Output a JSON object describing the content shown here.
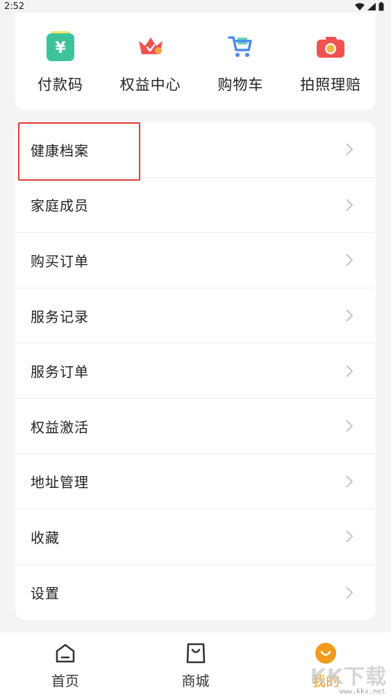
{
  "status": {
    "time": "2:52"
  },
  "quick_actions": [
    {
      "label": "付款码",
      "icon": "payment-code-icon",
      "color": "#3cc39b"
    },
    {
      "label": "权益中心",
      "icon": "crown-icon",
      "color": "#ef5350"
    },
    {
      "label": "购物车",
      "icon": "cart-icon",
      "color": "#4a8cf0"
    },
    {
      "label": "拍照理赔",
      "icon": "camera-icon",
      "color": "#ef5350"
    }
  ],
  "menu": [
    {
      "label": "健康档案"
    },
    {
      "label": "家庭成员"
    },
    {
      "label": "购买订单"
    },
    {
      "label": "服务记录"
    },
    {
      "label": "服务订单"
    },
    {
      "label": "权益激活"
    },
    {
      "label": "地址管理"
    },
    {
      "label": "收藏"
    },
    {
      "label": "设置"
    }
  ],
  "tabs": [
    {
      "label": "首页",
      "icon": "home-icon",
      "active": false
    },
    {
      "label": "商城",
      "icon": "shopping-bag-icon",
      "active": false
    },
    {
      "label": "我的",
      "icon": "profile-smile-icon",
      "active": true
    }
  ],
  "colors": {
    "accent": "#f29a1e",
    "highlight": "#e23b35"
  },
  "watermark": {
    "brand": "KK下载",
    "url": "www.kkx.net"
  }
}
